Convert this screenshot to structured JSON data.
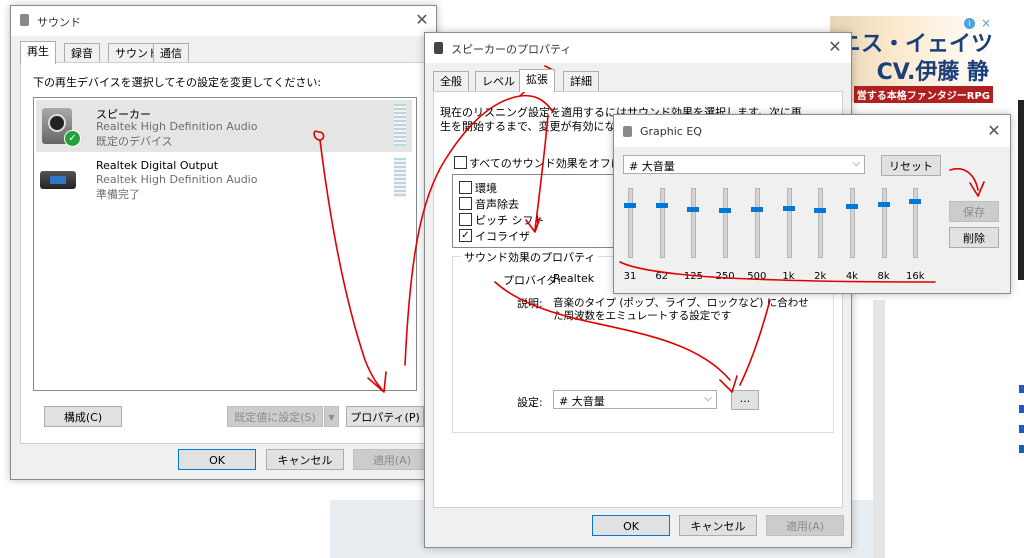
{
  "ad": {
    "line1": "ニス・イェイツ",
    "line2": "CV.伊藤 静",
    "line3": "営する本格ファンタジーRPG",
    "info_icon": "info-icon",
    "close_icon": "close-icon"
  },
  "sound_dialog": {
    "title": "サウンド",
    "tabs": [
      "再生",
      "録音",
      "サウンド",
      "通信"
    ],
    "instruction": "下の再生デバイスを選択してその設定を変更してください:",
    "devices": [
      {
        "name": "スピーカー",
        "driver": "Realtek High Definition Audio",
        "status": "既定のデバイス",
        "icon": "speaker-icon"
      },
      {
        "name": "Realtek Digital Output",
        "driver": "Realtek High Definition Audio",
        "status": "準備完了",
        "icon": "digital-output-icon"
      }
    ],
    "buttons": {
      "configure": "構成(C)",
      "set_default": "既定値に設定(S)",
      "properties": "プロパティ(P)",
      "ok": "OK",
      "cancel": "キャンセル",
      "apply": "適用(A)"
    }
  },
  "speaker_dialog": {
    "title": "スピーカーのプロパティ",
    "tabs": [
      "全般",
      "レベル",
      "拡張",
      "詳細"
    ],
    "description_line1": "現在のリスニング設定を適用するにはサウンド効果を選択します。次に再",
    "description_line2": "生を開始するまで、変更が有効になら",
    "disable_all_label": "すべてのサウンド効果をオフにする",
    "effects": [
      {
        "label": "環境",
        "checked": false
      },
      {
        "label": "音声除去",
        "checked": false
      },
      {
        "label": "ピッチ シフト",
        "checked": false
      },
      {
        "label": "イコライザ",
        "checked": true
      }
    ],
    "group_title": "サウンド効果のプロパティ",
    "provider_label": "プロバイダ:",
    "provider_value": "Realtek",
    "description_label": "説明:",
    "effect_description_line1": "音楽のタイプ (ポップ、ライブ、ロックなど) に合わせ",
    "effect_description_line2": "た周波数をエミュレートする設定です",
    "setting_label": "設定:",
    "setting_value": "# 大音量",
    "more_button": "...",
    "buttons": {
      "ok": "OK",
      "cancel": "キャンセル",
      "apply": "適用(A)"
    }
  },
  "eq_dialog": {
    "title": "Graphic EQ",
    "preset_value": "# 大音量",
    "reset": "リセット",
    "save": "保存",
    "delete": "削除",
    "bands": [
      {
        "label": "31",
        "level": 0.78
      },
      {
        "label": "62",
        "level": 0.78
      },
      {
        "label": "125",
        "level": 0.72
      },
      {
        "label": "250",
        "level": 0.7
      },
      {
        "label": "500",
        "level": 0.72
      },
      {
        "label": "1k",
        "level": 0.74
      },
      {
        "label": "2k",
        "level": 0.71
      },
      {
        "label": "4k",
        "level": 0.76
      },
      {
        "label": "8k",
        "level": 0.8
      },
      {
        "label": "16k",
        "level": 0.84
      }
    ]
  },
  "colors": {
    "accent": "#0078d7",
    "annotation": "#e00000",
    "selected_row": "#e5e5e5"
  }
}
